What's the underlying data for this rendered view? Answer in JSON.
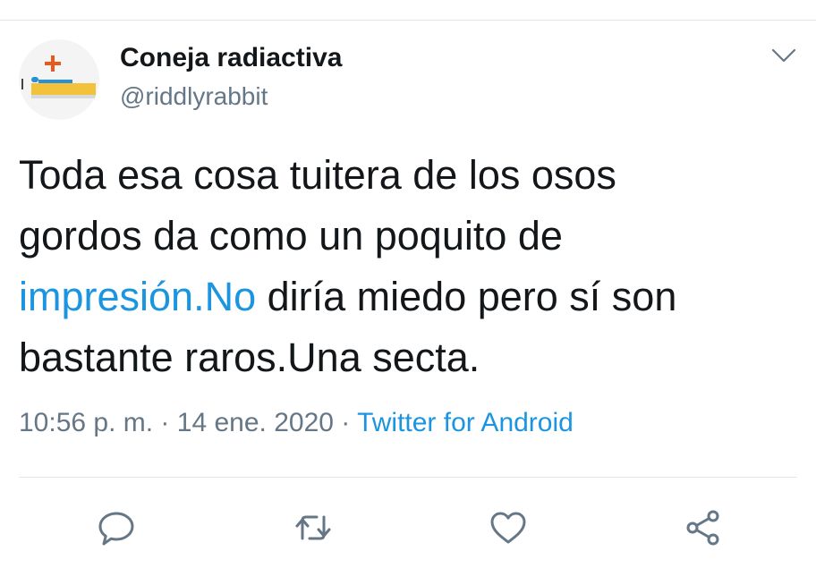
{
  "tweet": {
    "author": {
      "name": "Coneja radiactiva",
      "handle": "@riddlyrabbit",
      "avatar_icon": "avatar-image"
    },
    "text": {
      "line1": "Toda esa cosa tuitera de los osos",
      "line2": "gordos da como un poquito de",
      "line3_link": "impresión.No",
      "line3_rest": " diría miedo pero sí son",
      "line4": "bastante raros.Una secta."
    },
    "meta": {
      "time": "10:56 p. m.",
      "separator1": " · ",
      "date": "14 ene. 2020",
      "separator2": " · ",
      "source": "Twitter for Android"
    },
    "actions": [
      {
        "icon": "reply-icon"
      },
      {
        "icon": "retweet-icon"
      },
      {
        "icon": "like-icon"
      },
      {
        "icon": "share-icon"
      }
    ]
  },
  "colors": {
    "text": "#14171a",
    "secondary": "#657786",
    "link": "#1b95e0",
    "divider": "#e1e8ed",
    "icon": "#657786"
  }
}
